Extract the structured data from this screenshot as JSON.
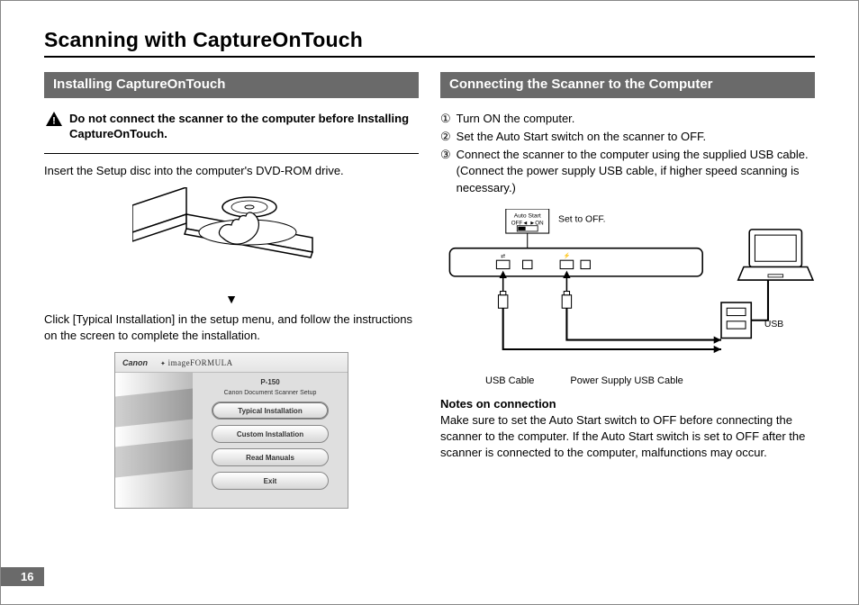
{
  "page": {
    "title": "Scanning with CaptureOnTouch",
    "number": "16"
  },
  "left": {
    "heading": "Installing CaptureOnTouch",
    "warning": "Do not connect the scanner to the computer before Installing CaptureOnTouch.",
    "insert_disc": "Insert the Setup disc into the computer's DVD-ROM drive.",
    "click_typical": "Click [Typical Installation] in the setup menu, and follow the instructions on the screen to complete the installation.",
    "setup": {
      "brand": "Canon",
      "product_line": "imageFORMULA",
      "model": "P-150",
      "subtitle": "Canon Document Scanner Setup",
      "buttons": [
        "Typical Installation",
        "Custom Installation",
        "Read Manuals",
        "Exit"
      ]
    }
  },
  "right": {
    "heading": "Connecting the Scanner to the Computer",
    "steps": [
      "Turn ON the computer.",
      "Set the Auto Start switch on the scanner to OFF.",
      "Connect the scanner to the computer using the supplied USB cable. (Connect the power supply USB cable, if higher speed scanning is necessary.)"
    ],
    "step_markers": [
      "①",
      "②",
      "③"
    ],
    "diagram": {
      "auto_start_label": "Auto Start",
      "auto_start_positions": "OFF◄  ►ON",
      "set_to_off": "Set to OFF.",
      "usb_hub_label": "USB",
      "usb_cable_label": "USB Cable",
      "power_cable_label": "Power Supply USB Cable"
    },
    "notes_heading": "Notes on connection",
    "notes_body": "Make sure to set the Auto Start switch to OFF before connecting the scanner to the computer. If the Auto Start switch is set to OFF after the scanner is connected to the computer, malfunctions may occur."
  }
}
